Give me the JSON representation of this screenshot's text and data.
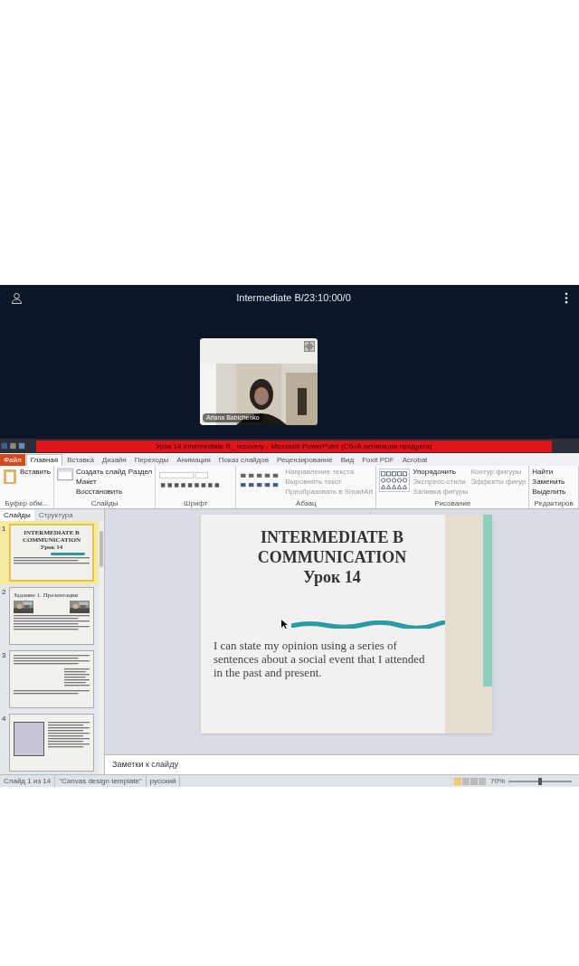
{
  "call": {
    "title": "Intermediate B/23:10:00/0",
    "participant": {
      "name": "Ariana Babichenko",
      "kind": "picture"
    }
  },
  "powerpoint": {
    "title": "Урок 14 Intermediate B_ recovery - Microsoft PowerPoint (Сбой активации продукта)",
    "ribbon_tabs": [
      {
        "label": "Файл",
        "kind": "file",
        "selected": false
      },
      {
        "label": "Главная",
        "kind": "tab",
        "selected": true
      },
      {
        "label": "Вставка",
        "kind": "tab",
        "selected": false
      },
      {
        "label": "Дизайн",
        "kind": "tab",
        "selected": false
      },
      {
        "label": "Переходы",
        "kind": "tab",
        "selected": false
      },
      {
        "label": "Анимация",
        "kind": "tab",
        "selected": false
      },
      {
        "label": "Показ слайдов",
        "kind": "tab",
        "selected": false
      },
      {
        "label": "Рецензирование",
        "kind": "tab",
        "selected": false
      },
      {
        "label": "Вид",
        "kind": "tab",
        "selected": false
      },
      {
        "label": "Foxit PDF",
        "kind": "tab",
        "selected": false
      },
      {
        "label": "Acrobat",
        "kind": "tab",
        "selected": false
      }
    ],
    "ribbon_groups": [
      {
        "label": "Буфер обм...",
        "kind": "clipboard",
        "commands": [
          {
            "label": "Вставить",
            "disabled": false
          }
        ]
      },
      {
        "label": "Слайды",
        "kind": "slides",
        "commands": [
          {
            "label": "Создать слайд",
            "disabled": false
          },
          {
            "label": "Макет",
            "disabled": false
          },
          {
            "label": "Восстановить",
            "disabled": false
          },
          {
            "label": "Раздел",
            "disabled": false
          }
        ]
      },
      {
        "label": "Шрифт",
        "kind": "font"
      },
      {
        "label": "Абзац",
        "kind": "paragraph",
        "commands": [
          {
            "label": "Направление текста",
            "disabled": true
          },
          {
            "label": "Выровнять текст",
            "disabled": true
          },
          {
            "label": "Преобразовать в SmartArt",
            "disabled": true
          }
        ]
      },
      {
        "label": "Рисование",
        "kind": "drawing",
        "commands": [
          {
            "label": "Упорядочить",
            "disabled": false
          },
          {
            "label": "Экспресс-стили",
            "disabled": true
          },
          {
            "label": "Заливка фигуры",
            "disabled": true
          },
          {
            "label": "Контур фигуры",
            "disabled": true
          },
          {
            "label": "Эффекты фигур",
            "disabled": true
          }
        ]
      },
      {
        "label": "Редактиров",
        "kind": "editing",
        "commands": [
          {
            "label": "Найти",
            "disabled": false
          },
          {
            "label": "Заменить",
            "disabled": false
          },
          {
            "label": "Выделить",
            "disabled": false
          }
        ]
      }
    ],
    "panel_tabs": [
      {
        "label": "Слайды",
        "selected": true
      },
      {
        "label": "Структура",
        "selected": false
      }
    ],
    "thumbnails": [
      {
        "number": "1",
        "kind": "title",
        "selected": true,
        "title_lines": [
          "INTERMEDIATE B",
          "COMMUNICATION",
          "Урок 14"
        ]
      },
      {
        "number": "2",
        "kind": "photos",
        "selected": false,
        "title_lines": [
          "Задание 1. Презентация"
        ]
      },
      {
        "number": "3",
        "kind": "text",
        "selected": false
      },
      {
        "number": "4",
        "kind": "table",
        "selected": false
      }
    ],
    "slide": {
      "title_lines": [
        "INTERMEDIATE B",
        "COMMUNICATION",
        "Урок 14"
      ],
      "body": "I can state my opinion using a series of sentences about a social event that I attended in the past and present."
    },
    "notes_placeholder": "Заметки к слайду",
    "status_bar": [
      "Слайд 1 из 14",
      "\"Canvas design template\"",
      "русский"
    ],
    "zoom": "70%",
    "zoom_slider": {
      "level": 0.5
    }
  }
}
